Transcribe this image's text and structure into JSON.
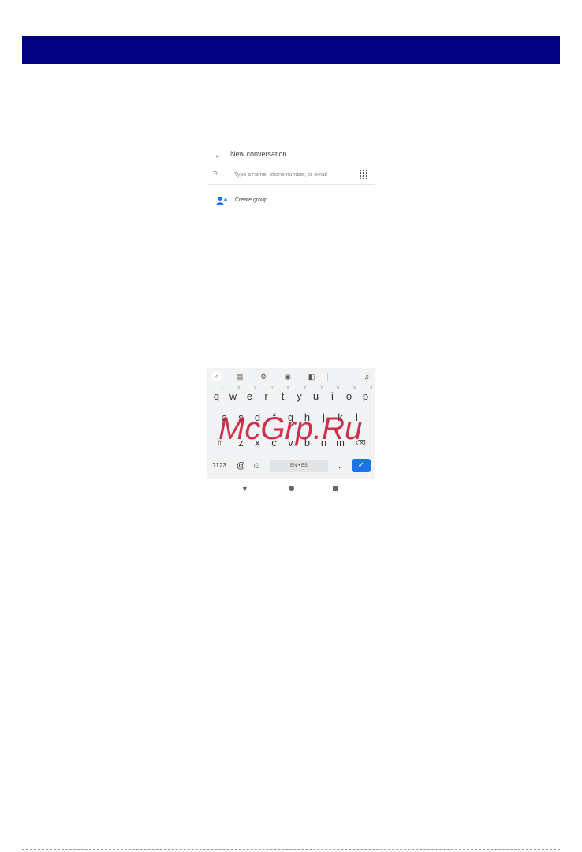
{
  "header": {
    "banner_color": "#000080"
  },
  "conversation": {
    "title": "New conversation",
    "to_label": "To",
    "to_placeholder": "Type a name, phone number, or email",
    "create_group_label": "Create group",
    "accent_color": "#1a73e8"
  },
  "keyboard": {
    "toolbar_icons": [
      "back-arrow-icon",
      "clipboard-icon",
      "gear-icon",
      "palette-icon",
      "resize-icon",
      "more-icon",
      "mic-off-icon"
    ],
    "row1": [
      "q",
      "w",
      "e",
      "r",
      "t",
      "y",
      "u",
      "i",
      "o",
      "p"
    ],
    "row1_hints": [
      "1",
      "2",
      "3",
      "4",
      "5",
      "6",
      "7",
      "8",
      "9",
      "0"
    ],
    "row2": [
      "a",
      "s",
      "d",
      "f",
      "g",
      "h",
      "j",
      "k",
      "l"
    ],
    "row3": [
      "z",
      "x",
      "c",
      "v",
      "b",
      "n",
      "m"
    ],
    "symbols_key": "?123",
    "at_key": "@",
    "space_label": "EN • ES",
    "period_key": ".",
    "enter_color": "#1a73e8"
  },
  "watermark": {
    "text": "McGrp.Ru",
    "color": "#c8102e"
  },
  "navigation": {
    "icons": [
      "nav-back-icon",
      "nav-home-icon",
      "nav-recents-icon"
    ]
  }
}
